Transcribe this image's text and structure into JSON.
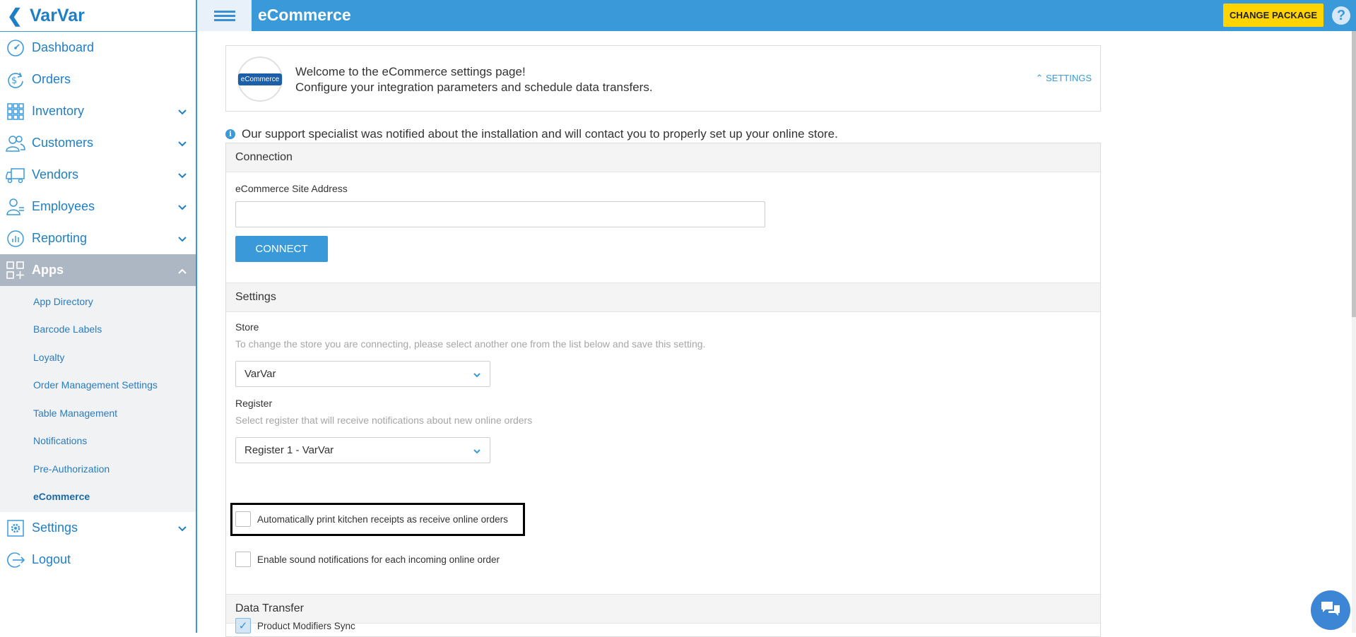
{
  "sidebar": {
    "title": "VarVar",
    "items": [
      {
        "label": "Dashboard"
      },
      {
        "label": "Orders"
      },
      {
        "label": "Inventory"
      },
      {
        "label": "Customers"
      },
      {
        "label": "Vendors"
      },
      {
        "label": "Employees"
      },
      {
        "label": "Reporting"
      },
      {
        "label": "Apps"
      }
    ],
    "sub_items": [
      {
        "label": "App Directory"
      },
      {
        "label": "Barcode Labels"
      },
      {
        "label": "Loyalty"
      },
      {
        "label": "Order Management Settings"
      },
      {
        "label": "Table Management"
      },
      {
        "label": "Notifications"
      },
      {
        "label": "Pre-Authorization"
      },
      {
        "label": "eCommerce"
      }
    ],
    "bottom_items": [
      {
        "label": "Settings"
      },
      {
        "label": "Logout"
      }
    ]
  },
  "topbar": {
    "title": "eCommerce",
    "change_package": "CHANGE PACKAGE",
    "help": "?"
  },
  "welcome": {
    "logo_text": "eCommerce",
    "line1": "Welcome to the eCommerce settings page!",
    "line2": "Configure your integration parameters and schedule data transfers.",
    "settings_link": "SETTINGS"
  },
  "info": {
    "icon": "i",
    "text": "Our support specialist was notified about the installation and will contact you to properly set up your online store."
  },
  "connection": {
    "header": "Connection",
    "site_label": "eCommerce Site Address",
    "site_value": "",
    "connect_button": "CONNECT"
  },
  "settings": {
    "header": "Settings",
    "store_label": "Store",
    "store_hint": "To change the store you are connecting, please select another one from the list below and save this setting.",
    "store_value": "VarVar",
    "register_label": "Register",
    "register_hint": "Select register that will receive notifications about new online orders",
    "register_value": "Register 1 - VarVar",
    "auto_print_label": "Automatically print kitchen receipts as receive online orders",
    "auto_print_checked": false,
    "sound_label": "Enable sound notifications for each incoming online order",
    "sound_checked": false
  },
  "data_transfer": {
    "header": "Data Transfer",
    "modifiers_label": "Product Modifiers Sync",
    "modifiers_checked": true
  },
  "colors": {
    "accent": "#3a9ad9",
    "sidebar_active": "#adb7c4",
    "change_package_bg": "#ffd400"
  }
}
